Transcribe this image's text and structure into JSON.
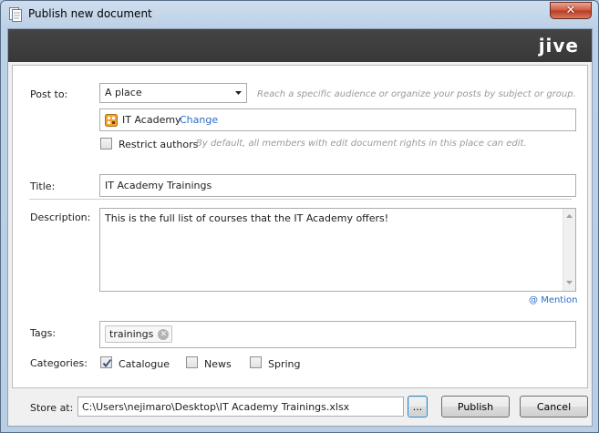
{
  "window": {
    "title": "Publish new document",
    "close_glyph": "✕"
  },
  "brand": {
    "logo": "jive"
  },
  "post_to": {
    "label": "Post to:",
    "selected": "A place",
    "hint": "Reach a specific audience or organize your posts by subject or group.",
    "place_name": "IT Academy",
    "change_link": "Change",
    "restrict_label": "Restrict authors",
    "restrict_checked": false,
    "restrict_hint": "By default, all members with edit document rights in this place can edit."
  },
  "title_field": {
    "label": "Title:",
    "value": "IT Academy Trainings"
  },
  "description": {
    "label": "Description:",
    "value": "This is the full list of courses that the IT Academy offers!",
    "mention_link": "Mention",
    "mention_icon": "@"
  },
  "tags": {
    "label": "Tags:",
    "items": [
      {
        "text": "trainings",
        "remove_glyph": "✕"
      }
    ]
  },
  "categories": {
    "label": "Categories:",
    "items": [
      {
        "label": "Catalogue",
        "checked": true
      },
      {
        "label": "News",
        "checked": false
      },
      {
        "label": "Spring",
        "checked": false
      }
    ]
  },
  "footer": {
    "store_label": "Store at:",
    "store_path": "C:\\Users\\nejimaro\\Desktop\\IT Academy Trainings.xlsx",
    "browse_label": "...",
    "publish_label": "Publish",
    "cancel_label": "Cancel"
  },
  "colors": {
    "banner": "#3c3c3c",
    "link": "#2b6cc4",
    "panel": "#ffffff",
    "frame": "#b9cde3"
  }
}
